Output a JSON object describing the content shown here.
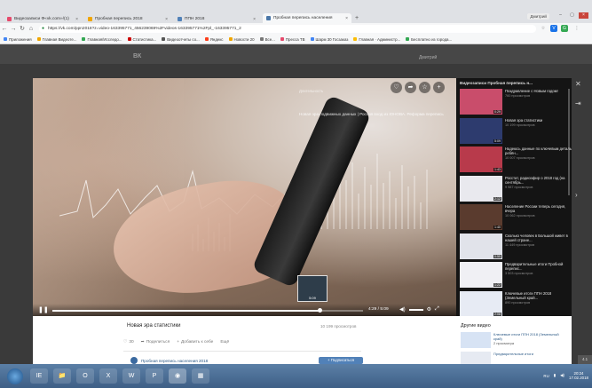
{
  "browser": {
    "tabs": [
      {
        "label": "Видеозаписи Ф«vk.com»/(1)",
        "color": "#e64a6c"
      },
      {
        "label": "Пробная перепись 2018",
        "color": "#f0a500"
      },
      {
        "label": "ППН 2018",
        "color": "#5181b8"
      },
      {
        "label": "Пробная перепись населения",
        "color": "#4a76a8"
      }
    ],
    "url": "https://vk.com/ppn2018?z=video-163395771_456239069%2Fvideos-163395771%2Fpl_-163395771_2",
    "profile": "Дмитрий",
    "bookmarks": [
      {
        "label": "Приложения",
        "color": "#4285f4"
      },
      {
        "label": "Главная Видеоте...",
        "color": "#f0a500"
      },
      {
        "label": "Главная/Исследо...",
        "color": "#34a853"
      },
      {
        "label": "Статистика...",
        "color": "#c00"
      },
      {
        "label": "Видеоотчеты со...",
        "color": "#555"
      },
      {
        "label": "Яндекс",
        "color": "#fc3f1d"
      },
      {
        "label": "Новости 20",
        "color": "#f0a500"
      },
      {
        "label": "Все...",
        "color": "#777"
      },
      {
        "label": "Пресса ТВ",
        "color": "#e64a6c"
      },
      {
        "label": "Шарм 30 Госзаказ",
        "color": "#4285f4"
      },
      {
        "label": "Главная · Администр...",
        "color": "#fbbc05"
      },
      {
        "label": "Бесплатно из города...",
        "color": "#34a853"
      }
    ]
  },
  "vk": {
    "logo": "ВК",
    "user": "Дмитрий"
  },
  "player": {
    "tag": "Длительность",
    "overlay_title": "Новая эра подвижных данных | Россия вход из ЮНОВА. Реформа перепись",
    "time": "4:29 / 5:09",
    "progress": 0.86
  },
  "playlist": {
    "header": "Видеозаписи Пробная перепись н...",
    "items": [
      {
        "title": "Поздравление с Новым годом!",
        "views": "760 просмотров",
        "duration": "0:29",
        "color": "#c94d6b"
      },
      {
        "title": "Новая эра статистики",
        "views": "10 199 просмотров",
        "duration": "5:09",
        "color": "#2d3b6e"
      },
      {
        "title": "Надеюсь данные по ключевым деталь ребён...",
        "views": "10 007 просмотров",
        "duration": "1:43",
        "color": "#b83a4b"
      },
      {
        "title": "Росстат, радиоэфир о 2018 год (на сентябрь...",
        "views": "9 987 просмотров",
        "duration": "2:12",
        "color": "#e9e9ee"
      },
      {
        "title": "Население России теперь сегодня, вчера",
        "views": "10 062 просмотров",
        "duration": "1:40",
        "color": "#5a3b2e"
      },
      {
        "title": "Сколько человек в Большой живет в нашей стране...",
        "views": "11 449 просмотров",
        "duration": "0:55",
        "color": "#e1e3ea"
      },
      {
        "title": "Предварительные итоги Пробной перепис...",
        "views": "3 503 просмотров",
        "duration": "1:22",
        "color": "#f0f0f4"
      },
      {
        "title": "Ключевые итоги ППН 2018 (Земельный край...",
        "views": "890 просмотров",
        "duration": "2:08",
        "color": "#e7ebf4"
      }
    ]
  },
  "info": {
    "title": "Новая эра статистики",
    "views": "10 199 просмотров",
    "likes": "30",
    "share": "Поделиться",
    "add": "Добавить к себе",
    "more": "Ещё",
    "channel": "Пробная перепись населения 2018",
    "subscribe": "+ Подписаться",
    "other_header": "Другие видео",
    "other": [
      {
        "title": "Ключевые итоги ППН 2018 (Земельный край)",
        "meta": "2 просмотра",
        "color": "#d7e3f4"
      },
      {
        "title": "Предварительные итоги",
        "meta": "",
        "color": "#e6eaf2"
      }
    ]
  },
  "taskbar": {
    "apps": [
      "IE",
      "📁",
      "O",
      "X",
      "W",
      "P",
      "◉",
      "▦"
    ],
    "time": "20:24",
    "date": "17.02.2018",
    "lang": "RU",
    "dock": "4.1"
  }
}
